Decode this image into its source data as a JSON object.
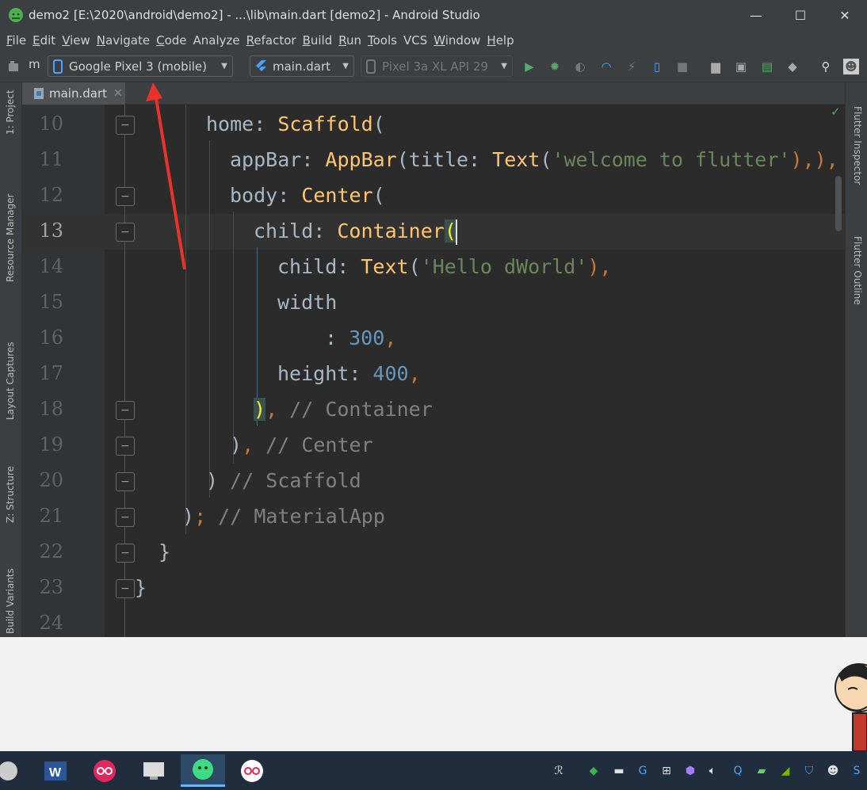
{
  "window": {
    "title": "demo2 [E:\\2020\\android\\demo2] - ...\\lib\\main.dart [demo2] - Android Studio",
    "minimize": "—",
    "maximize": "☐",
    "close": "✕"
  },
  "menu": [
    {
      "u": "F",
      "rest": "ile"
    },
    {
      "u": "E",
      "rest": "dit"
    },
    {
      "u": "V",
      "rest": "iew"
    },
    {
      "u": "N",
      "rest": "avigate"
    },
    {
      "u": "C",
      "rest": "ode"
    },
    {
      "u": "",
      "rest": "Analyze"
    },
    {
      "u": "R",
      "rest": "efactor"
    },
    {
      "u": "B",
      "rest": "uild"
    },
    {
      "u": "R",
      "rest": "un"
    },
    {
      "u": "T",
      "rest": "ools"
    },
    {
      "u": "",
      "rest": "VCS"
    },
    {
      "u": "W",
      "rest": "indow"
    },
    {
      "u": "H",
      "rest": "elp"
    }
  ],
  "toolbar": {
    "breadcrumb": "m",
    "device_selector": "Google Pixel 3 (mobile)",
    "run_config": "main.dart",
    "emulator": "Pixel 3a XL API 29"
  },
  "tab": {
    "label": "main.dart",
    "close": "✕"
  },
  "side_panels": {
    "left": [
      "1: Project",
      "Resource Manager",
      "Layout Captures",
      "Z: Structure",
      "Build Variants"
    ],
    "right": [
      "Flutter Inspector",
      "Flutter Outline"
    ]
  },
  "editor": {
    "line_numbers": [
      "10",
      "11",
      "12",
      "13",
      "14",
      "15",
      "16",
      "17",
      "18",
      "19",
      "20",
      "21",
      "22",
      "23",
      "24"
    ],
    "current_line": "13",
    "code": {
      "l10": {
        "a": "home",
        "b": ": ",
        "c": "Scaffold",
        "d": "("
      },
      "l11": {
        "a": "appBar",
        "b": ": ",
        "c": "AppBar",
        "d": "(title: ",
        "e": "Text",
        "f": "(",
        "g": "'welcome to flutter'",
        "h": "),),"
      },
      "l12": {
        "a": "body",
        "b": ": ",
        "c": "Center",
        "d": "("
      },
      "l13": {
        "a": "child",
        "b": ": ",
        "c": "Container",
        "d": "("
      },
      "l14": {
        "a": "child",
        "b": ": ",
        "c": "Text",
        "d": "(",
        "e": "'Hello dWorld'",
        "f": "),"
      },
      "l15": {
        "a": "width"
      },
      "l16": {
        "a": ": ",
        "b": "300",
        "c": ","
      },
      "l17": {
        "a": "height",
        "b": ": ",
        "c": "400",
        "d": ","
      },
      "l18": {
        "a": ")",
        "b": ", ",
        "c": "// Container"
      },
      "l19": {
        "a": ")",
        "b": ", ",
        "c": "// Center"
      },
      "l20": {
        "a": ") ",
        "b": "// Scaffold"
      },
      "l21": {
        "a": ")",
        "b": "; ",
        "c": "// MaterialApp"
      },
      "l22": {
        "a": "}"
      },
      "l23": {
        "a": "}"
      }
    }
  },
  "colors": {
    "keyword_class": "#ffc66d",
    "string": "#6a8759",
    "number": "#6897bb",
    "punct": "#cc7832",
    "comment": "#808080",
    "annotation_arrow": "#e8322b"
  }
}
